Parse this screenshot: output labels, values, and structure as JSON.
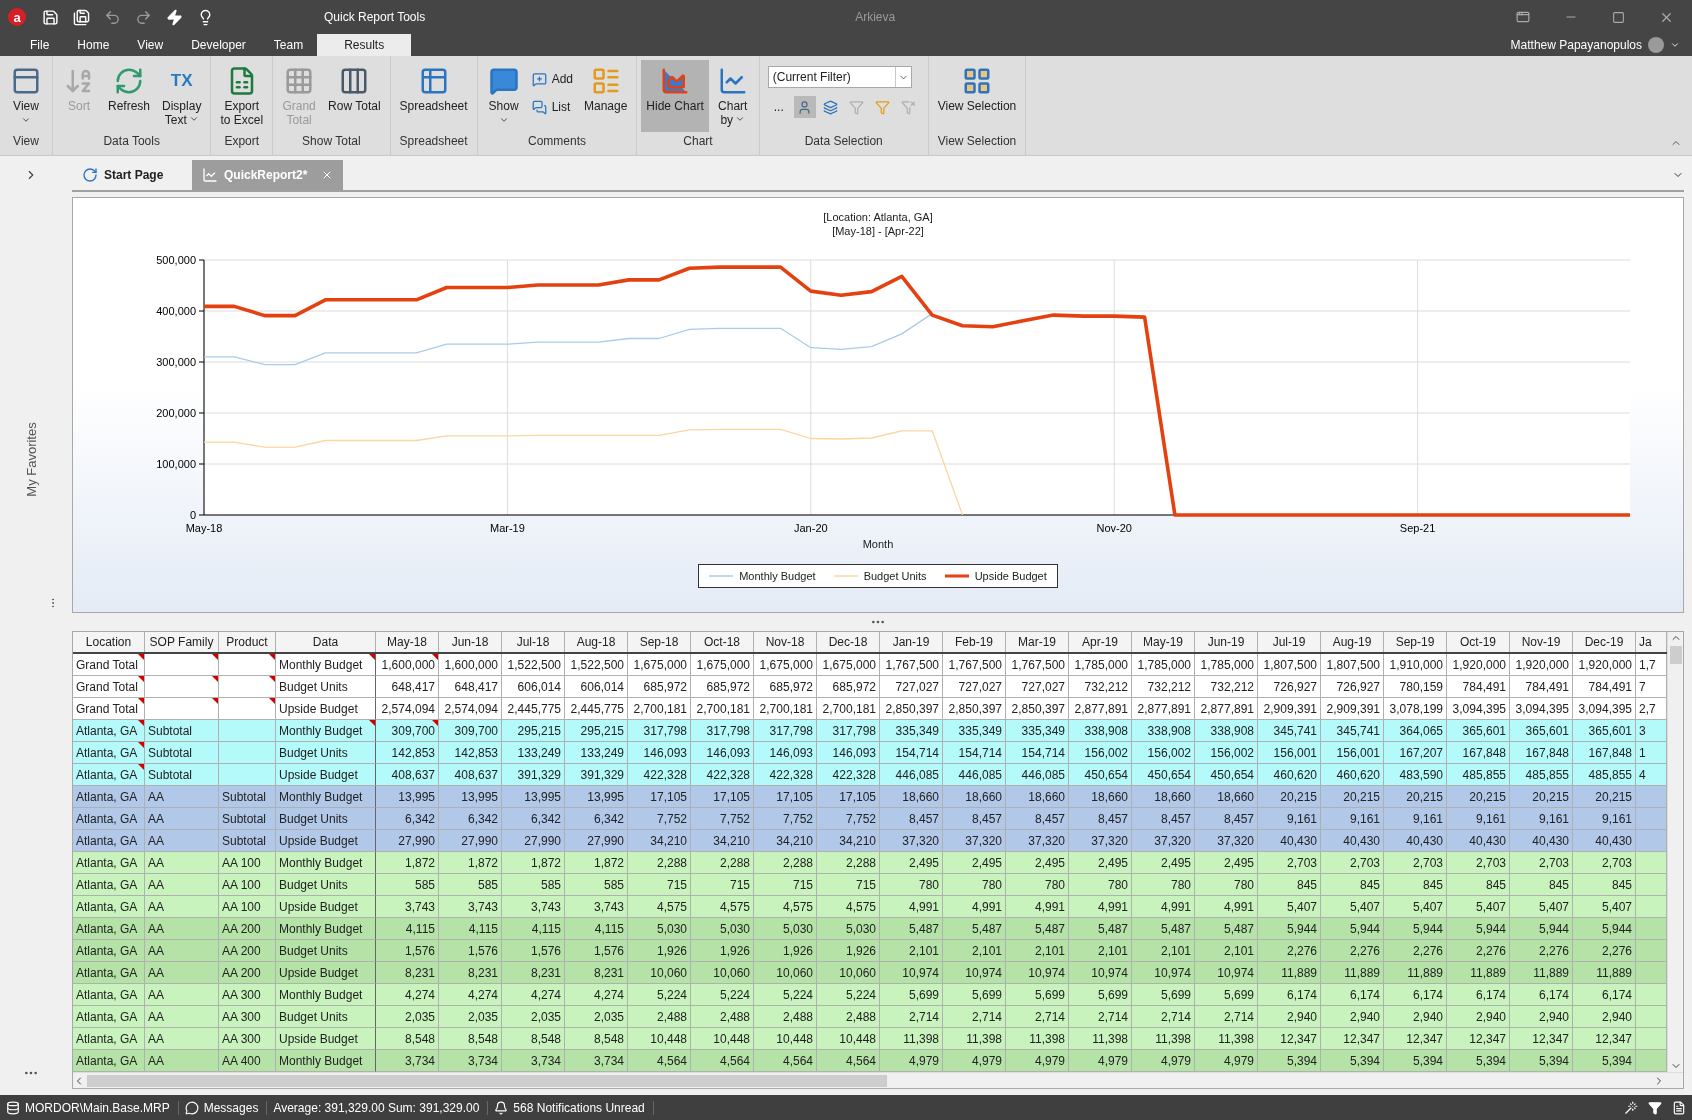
{
  "title_bar": {
    "app_badge": "a",
    "context_title": "Quick Report Tools",
    "app_name": "Arkieva"
  },
  "menu_tabs": [
    {
      "label": "File",
      "selected": false
    },
    {
      "label": "Home",
      "selected": false
    },
    {
      "label": "View",
      "selected": false
    },
    {
      "label": "Developer",
      "selected": false
    },
    {
      "label": "Team",
      "selected": false
    },
    {
      "label": "Results",
      "selected": true
    }
  ],
  "user": {
    "name": "Matthew Papayanopulos"
  },
  "ribbon": {
    "groups": [
      {
        "label": "View",
        "items": [
          {
            "kind": "large",
            "label": "View",
            "dropdown": true,
            "disabled": false,
            "pressed": false
          }
        ]
      },
      {
        "label": "Data Tools",
        "items": [
          {
            "kind": "large",
            "label": "Sort",
            "disabled": true,
            "pressed": false
          },
          {
            "kind": "large",
            "label": "Refresh",
            "disabled": false,
            "pressed": false
          },
          {
            "kind": "large",
            "label": "Display\nText",
            "glyph": "TX",
            "dropdown": true,
            "disabled": false,
            "pressed": false
          }
        ]
      },
      {
        "label": "Export",
        "items": [
          {
            "kind": "large",
            "label": "Export\nto Excel",
            "disabled": false,
            "pressed": false
          }
        ]
      },
      {
        "label": "Show Total",
        "items": [
          {
            "kind": "large",
            "label": "Grand\nTotal",
            "disabled": true,
            "pressed": false
          },
          {
            "kind": "large",
            "label": "Row Total",
            "disabled": false,
            "pressed": false
          }
        ]
      },
      {
        "label": "Spreadsheet",
        "items": [
          {
            "kind": "large",
            "label": "Spreadsheet",
            "disabled": false,
            "pressed": false
          }
        ]
      },
      {
        "label": "Comments",
        "items": [
          {
            "kind": "large",
            "label": "Show",
            "dropdown": true,
            "disabled": false,
            "pressed": false
          },
          {
            "kind": "stack",
            "items": [
              {
                "label": "Add"
              },
              {
                "label": "List"
              }
            ]
          },
          {
            "kind": "large",
            "label": "Manage",
            "disabled": false,
            "pressed": false
          }
        ]
      },
      {
        "label": "Chart",
        "items": [
          {
            "kind": "large",
            "label": "Hide Chart",
            "disabled": false,
            "pressed": true
          },
          {
            "kind": "large",
            "label": "Chart\nby",
            "dropdown": true,
            "disabled": false,
            "pressed": false
          }
        ]
      },
      {
        "label": "Data Selection",
        "items": [
          {
            "kind": "selection",
            "value": "(Current Filter)",
            "more": "...",
            "tools": [
              {
                "pressed": true,
                "disabled": false
              },
              {
                "pressed": false,
                "disabled": false
              },
              {
                "pressed": false,
                "disabled": true
              },
              {
                "pressed": false,
                "disabled": false
              },
              {
                "pressed": false,
                "disabled": true
              }
            ]
          }
        ]
      },
      {
        "label": "View Selection",
        "items": [
          {
            "kind": "large",
            "label": "View Selection",
            "disabled": false,
            "pressed": false
          }
        ]
      }
    ]
  },
  "sidebar": {
    "label": "My Favorites"
  },
  "doc_tabs": [
    {
      "label": "Start Page",
      "selected": false,
      "closable": false
    },
    {
      "label": "QuickReport2*",
      "selected": true,
      "closable": true
    }
  ],
  "chart": {
    "range_label": "[May-18] - [Apr-22]",
    "chart_data": {
      "type": "line",
      "title": "[Location: Atlanta, GA]",
      "xlabel": "Month",
      "grid": true,
      "categories": [
        "May-18",
        null,
        null,
        null,
        null,
        null,
        null,
        null,
        null,
        null,
        "Mar-19",
        null,
        null,
        null,
        null,
        null,
        null,
        null,
        null,
        null,
        "Jan-20",
        null,
        null,
        null,
        null,
        null,
        null,
        null,
        null,
        null,
        "Nov-20",
        null,
        null,
        null,
        null,
        null,
        null,
        null,
        null,
        null,
        "Sep-21",
        null,
        null,
        null,
        null,
        null,
        null,
        null
      ],
      "series": [
        {
          "name": "Monthly Budget",
          "color": "#a9cbe8",
          "values": [
            310000,
            310000,
            295000,
            295000,
            318000,
            318000,
            318000,
            318000,
            335000,
            335000,
            335000,
            339000,
            339000,
            339000,
            346000,
            346000,
            364000,
            366000,
            366000,
            366000,
            328000,
            325000,
            330000,
            355000,
            395000,
            null,
            null,
            null,
            null,
            null,
            null,
            null,
            null,
            null,
            null,
            null,
            null,
            null,
            null,
            null,
            null,
            null,
            null,
            null,
            null,
            null,
            null,
            null
          ]
        },
        {
          "name": "Budget Units",
          "color": "#fcd5a0",
          "values": [
            143000,
            143000,
            133000,
            133000,
            146000,
            146000,
            146000,
            146000,
            155000,
            155000,
            155000,
            156000,
            156000,
            156000,
            156000,
            156000,
            167000,
            168000,
            168000,
            168000,
            150000,
            149000,
            151000,
            165000,
            165000,
            0,
            null,
            null,
            null,
            null,
            null,
            null,
            null,
            null,
            null,
            null,
            null,
            null,
            null,
            null,
            null,
            null,
            null,
            null,
            null,
            null,
            null,
            null
          ]
        },
        {
          "name": "Upside Budget",
          "color": "#e5400f",
          "values": [
            409000,
            409000,
            391000,
            391000,
            422000,
            422000,
            422000,
            422000,
            446000,
            446000,
            446000,
            451000,
            451000,
            451000,
            461000,
            461000,
            484000,
            486000,
            486000,
            486000,
            439000,
            431000,
            438000,
            468000,
            392000,
            371000,
            369000,
            381000,
            392000,
            390000,
            390000,
            388000,
            0,
            0,
            0,
            0,
            0,
            0,
            0,
            0,
            0,
            0,
            0,
            0,
            0,
            0,
            0,
            0
          ]
        }
      ],
      "ylim": [
        0,
        500000
      ],
      "yticks": [
        {
          "value": 0,
          "label": "0"
        },
        {
          "value": 100000,
          "label": "100,000"
        },
        {
          "value": 200000,
          "label": "200,000"
        },
        {
          "value": 300000,
          "label": "300,000"
        },
        {
          "value": 400000,
          "label": "400,000"
        },
        {
          "value": 500000,
          "label": "500,000"
        }
      ]
    }
  },
  "table": {
    "columns": [
      {
        "label": "Location",
        "partial": false
      },
      {
        "label": "SOP Family",
        "partial": false
      },
      {
        "label": "Product",
        "partial": false
      },
      {
        "label": "Data",
        "partial": false
      },
      {
        "label": "May-18",
        "partial": false
      },
      {
        "label": "Jun-18",
        "partial": false
      },
      {
        "label": "Jul-18",
        "partial": false
      },
      {
        "label": "Aug-18",
        "partial": false
      },
      {
        "label": "Sep-18",
        "partial": false
      },
      {
        "label": "Oct-18",
        "partial": false
      },
      {
        "label": "Nov-18",
        "partial": false
      },
      {
        "label": "Dec-18",
        "partial": false
      },
      {
        "label": "Jan-19",
        "partial": false
      },
      {
        "label": "Feb-19",
        "partial": false
      },
      {
        "label": "Mar-19",
        "partial": false
      },
      {
        "label": "Apr-19",
        "partial": false
      },
      {
        "label": "May-19",
        "partial": false
      },
      {
        "label": "Jun-19",
        "partial": false
      },
      {
        "label": "Jul-19",
        "partial": false
      },
      {
        "label": "Aug-19",
        "partial": false
      },
      {
        "label": "Sep-19",
        "partial": false
      },
      {
        "label": "Oct-19",
        "partial": false
      },
      {
        "label": "Nov-19",
        "partial": false
      },
      {
        "label": "Dec-19",
        "partial": false
      },
      {
        "label": "Ja",
        "partial": true
      }
    ],
    "rows": [
      {
        "kind": "grand",
        "location": "Grand Total",
        "data": "Monthly Budget",
        "marks": {
          "location": true,
          "sop_family": true,
          "product": true,
          "data": true,
          "first_value": true
        },
        "values": [
          "1,600,000",
          "1,600,000",
          "1,522,500",
          "1,522,500",
          "1,675,000",
          "1,675,000",
          "1,675,000",
          "1,675,000",
          "1,767,500",
          "1,767,500",
          "1,767,500",
          "1,785,000",
          "1,785,000",
          "1,785,000",
          "1,807,500",
          "1,807,500",
          "1,910,000",
          "1,920,000",
          "1,920,000",
          "1,920,000",
          "1,7"
        ]
      },
      {
        "kind": "grand",
        "location": "Grand Total",
        "data": "Budget Units",
        "marks": {
          "location": true,
          "sop_family": true,
          "product": true,
          "data": false,
          "first_value": false
        },
        "values": [
          "648,417",
          "648,417",
          "606,014",
          "606,014",
          "685,972",
          "685,972",
          "685,972",
          "685,972",
          "727,027",
          "727,027",
          "727,027",
          "732,212",
          "732,212",
          "732,212",
          "726,927",
          "726,927",
          "780,159",
          "784,491",
          "784,491",
          "784,491",
          "7"
        ]
      },
      {
        "kind": "grand",
        "location": "Grand Total",
        "data": "Upside Budget",
        "marks": {
          "location": true,
          "sop_family": true,
          "product": true,
          "data": false,
          "first_value": false
        },
        "values": [
          "2,574,094",
          "2,574,094",
          "2,445,775",
          "2,445,775",
          "2,700,181",
          "2,700,181",
          "2,700,181",
          "2,700,181",
          "2,850,397",
          "2,850,397",
          "2,850,397",
          "2,877,891",
          "2,877,891",
          "2,877,891",
          "2,909,391",
          "2,909,391",
          "3,078,199",
          "3,094,395",
          "3,094,395",
          "3,094,395",
          "2,7"
        ]
      },
      {
        "kind": "location",
        "location": "Atlanta, GA",
        "sop_family": "Subtotal",
        "data": "Monthly Budget",
        "marks": {
          "location": true,
          "sop_family": false,
          "product": false,
          "data": true,
          "first_value": true
        },
        "values": [
          "309,700",
          "309,700",
          "295,215",
          "295,215",
          "317,798",
          "317,798",
          "317,798",
          "317,798",
          "335,349",
          "335,349",
          "335,349",
          "338,908",
          "338,908",
          "338,908",
          "345,741",
          "345,741",
          "364,065",
          "365,601",
          "365,601",
          "365,601",
          "3"
        ]
      },
      {
        "kind": "location",
        "location": "Atlanta, GA",
        "sop_family": "Subtotal",
        "data": "Budget Units",
        "marks": {
          "location": true,
          "sop_family": false,
          "product": false,
          "data": false,
          "first_value": false
        },
        "values": [
          "142,853",
          "142,853",
          "133,249",
          "133,249",
          "146,093",
          "146,093",
          "146,093",
          "146,093",
          "154,714",
          "154,714",
          "154,714",
          "156,002",
          "156,002",
          "156,002",
          "156,001",
          "156,001",
          "167,207",
          "167,848",
          "167,848",
          "167,848",
          "1"
        ]
      },
      {
        "kind": "location",
        "location": "Atlanta, GA",
        "sop_family": "Subtotal",
        "data": "Upside Budget",
        "marks": {
          "location": true,
          "sop_family": false,
          "product": false,
          "data": false,
          "first_value": false
        },
        "values": [
          "408,637",
          "408,637",
          "391,329",
          "391,329",
          "422,328",
          "422,328",
          "422,328",
          "422,328",
          "446,085",
          "446,085",
          "446,085",
          "450,654",
          "450,654",
          "450,654",
          "460,620",
          "460,620",
          "483,590",
          "485,855",
          "485,855",
          "485,855",
          "4"
        ]
      },
      {
        "kind": "family",
        "location": "Atlanta, GA",
        "sop_family": "AA",
        "product": "Subtotal",
        "data": "Monthly Budget",
        "marks": {
          "location": false,
          "sop_family": false,
          "product": false,
          "data": false,
          "first_value": false
        },
        "values": [
          "13,995",
          "13,995",
          "13,995",
          "13,995",
          "17,105",
          "17,105",
          "17,105",
          "17,105",
          "18,660",
          "18,660",
          "18,660",
          "18,660",
          "18,660",
          "18,660",
          "20,215",
          "20,215",
          "20,215",
          "20,215",
          "20,215",
          "20,215"
        ]
      },
      {
        "kind": "family",
        "location": "Atlanta, GA",
        "sop_family": "AA",
        "product": "Subtotal",
        "data": "Budget Units",
        "marks": {
          "location": false,
          "sop_family": false,
          "product": false,
          "data": false,
          "first_value": false
        },
        "values": [
          "6,342",
          "6,342",
          "6,342",
          "6,342",
          "7,752",
          "7,752",
          "7,752",
          "7,752",
          "8,457",
          "8,457",
          "8,457",
          "8,457",
          "8,457",
          "8,457",
          "9,161",
          "9,161",
          "9,161",
          "9,161",
          "9,161",
          "9,161"
        ]
      },
      {
        "kind": "family",
        "location": "Atlanta, GA",
        "sop_family": "AA",
        "product": "Subtotal",
        "data": "Upside Budget",
        "marks": {
          "location": false,
          "sop_family": false,
          "product": false,
          "data": false,
          "first_value": false
        },
        "values": [
          "27,990",
          "27,990",
          "27,990",
          "27,990",
          "34,210",
          "34,210",
          "34,210",
          "34,210",
          "37,320",
          "37,320",
          "37,320",
          "37,320",
          "37,320",
          "37,320",
          "40,430",
          "40,430",
          "40,430",
          "40,430",
          "40,430",
          "40,430"
        ]
      },
      {
        "kind": "product",
        "location": "Atlanta, GA",
        "sop_family": "AA",
        "product": "AA 100",
        "data": "Monthly Budget",
        "marks": {
          "location": false,
          "sop_family": false,
          "product": false,
          "data": false,
          "first_value": false
        },
        "values": [
          "1,872",
          "1,872",
          "1,872",
          "1,872",
          "2,288",
          "2,288",
          "2,288",
          "2,288",
          "2,495",
          "2,495",
          "2,495",
          "2,495",
          "2,495",
          "2,495",
          "2,703",
          "2,703",
          "2,703",
          "2,703",
          "2,703",
          "2,703"
        ]
      },
      {
        "kind": "product",
        "location": "Atlanta, GA",
        "sop_family": "AA",
        "product": "AA 100",
        "data": "Budget Units",
        "marks": {
          "location": false,
          "sop_family": false,
          "product": false,
          "data": false,
          "first_value": false
        },
        "values": [
          "585",
          "585",
          "585",
          "585",
          "715",
          "715",
          "715",
          "715",
          "780",
          "780",
          "780",
          "780",
          "780",
          "780",
          "845",
          "845",
          "845",
          "845",
          "845",
          "845"
        ]
      },
      {
        "kind": "product",
        "location": "Atlanta, GA",
        "sop_family": "AA",
        "product": "AA 100",
        "data": "Upside Budget",
        "marks": {
          "location": false,
          "sop_family": false,
          "product": false,
          "data": false,
          "first_value": false
        },
        "values": [
          "3,743",
          "3,743",
          "3,743",
          "3,743",
          "4,575",
          "4,575",
          "4,575",
          "4,575",
          "4,991",
          "4,991",
          "4,991",
          "4,991",
          "4,991",
          "4,991",
          "5,407",
          "5,407",
          "5,407",
          "5,407",
          "5,407",
          "5,407"
        ]
      },
      {
        "kind": "product_alt",
        "location": "Atlanta, GA",
        "sop_family": "AA",
        "product": "AA 200",
        "data": "Monthly Budget",
        "marks": {
          "location": false,
          "sop_family": false,
          "product": false,
          "data": false,
          "first_value": false
        },
        "values": [
          "4,115",
          "4,115",
          "4,115",
          "4,115",
          "5,030",
          "5,030",
          "5,030",
          "5,030",
          "5,487",
          "5,487",
          "5,487",
          "5,487",
          "5,487",
          "5,487",
          "5,944",
          "5,944",
          "5,944",
          "5,944",
          "5,944",
          "5,944"
        ]
      },
      {
        "kind": "product_alt",
        "location": "Atlanta, GA",
        "sop_family": "AA",
        "product": "AA 200",
        "data": "Budget Units",
        "marks": {
          "location": false,
          "sop_family": false,
          "product": false,
          "data": false,
          "first_value": false
        },
        "values": [
          "1,576",
          "1,576",
          "1,576",
          "1,576",
          "1,926",
          "1,926",
          "1,926",
          "1,926",
          "2,101",
          "2,101",
          "2,101",
          "2,101",
          "2,101",
          "2,101",
          "2,276",
          "2,276",
          "2,276",
          "2,276",
          "2,276",
          "2,276"
        ]
      },
      {
        "kind": "product_alt",
        "location": "Atlanta, GA",
        "sop_family": "AA",
        "product": "AA 200",
        "data": "Upside Budget",
        "marks": {
          "location": false,
          "sop_family": false,
          "product": false,
          "data": false,
          "first_value": false
        },
        "values": [
          "8,231",
          "8,231",
          "8,231",
          "8,231",
          "10,060",
          "10,060",
          "10,060",
          "10,060",
          "10,974",
          "10,974",
          "10,974",
          "10,974",
          "10,974",
          "10,974",
          "11,889",
          "11,889",
          "11,889",
          "11,889",
          "11,889",
          "11,889"
        ]
      },
      {
        "kind": "product",
        "location": "Atlanta, GA",
        "sop_family": "AA",
        "product": "AA 300",
        "data": "Monthly Budget",
        "marks": {
          "location": false,
          "sop_family": false,
          "product": false,
          "data": false,
          "first_value": false
        },
        "values": [
          "4,274",
          "4,274",
          "4,274",
          "4,274",
          "5,224",
          "5,224",
          "5,224",
          "5,224",
          "5,699",
          "5,699",
          "5,699",
          "5,699",
          "5,699",
          "5,699",
          "6,174",
          "6,174",
          "6,174",
          "6,174",
          "6,174",
          "6,174"
        ]
      },
      {
        "kind": "product",
        "location": "Atlanta, GA",
        "sop_family": "AA",
        "product": "AA 300",
        "data": "Budget Units",
        "marks": {
          "location": false,
          "sop_family": false,
          "product": false,
          "data": false,
          "first_value": false
        },
        "values": [
          "2,035",
          "2,035",
          "2,035",
          "2,035",
          "2,488",
          "2,488",
          "2,488",
          "2,488",
          "2,714",
          "2,714",
          "2,714",
          "2,714",
          "2,714",
          "2,714",
          "2,940",
          "2,940",
          "2,940",
          "2,940",
          "2,940",
          "2,940"
        ]
      },
      {
        "kind": "product",
        "location": "Atlanta, GA",
        "sop_family": "AA",
        "product": "AA 300",
        "data": "Upside Budget",
        "marks": {
          "location": false,
          "sop_family": false,
          "product": false,
          "data": false,
          "first_value": false
        },
        "values": [
          "8,548",
          "8,548",
          "8,548",
          "8,548",
          "10,448",
          "10,448",
          "10,448",
          "10,448",
          "11,398",
          "11,398",
          "11,398",
          "11,398",
          "11,398",
          "11,398",
          "12,347",
          "12,347",
          "12,347",
          "12,347",
          "12,347",
          "12,347"
        ]
      },
      {
        "kind": "product_alt",
        "location": "Atlanta, GA",
        "sop_family": "AA",
        "product": "AA 400",
        "data": "Monthly Budget",
        "marks": {
          "location": false,
          "sop_family": false,
          "product": false,
          "data": false,
          "first_value": false
        },
        "values": [
          "3,734",
          "3,734",
          "3,734",
          "3,734",
          "4,564",
          "4,564",
          "4,564",
          "4,564",
          "4,979",
          "4,979",
          "4,979",
          "4,979",
          "4,979",
          "4,979",
          "5,394",
          "5,394",
          "5,394",
          "5,394",
          "5,394",
          "5,394"
        ]
      }
    ]
  },
  "status_bar": {
    "items": [
      {
        "label": "MORDOR\\Main.Base.MRP"
      },
      {
        "label": "Messages"
      },
      {
        "label": "Average: 391,329.00 Sum: 391,329.00"
      },
      {
        "label": "568 Notifications Unread"
      }
    ]
  }
}
